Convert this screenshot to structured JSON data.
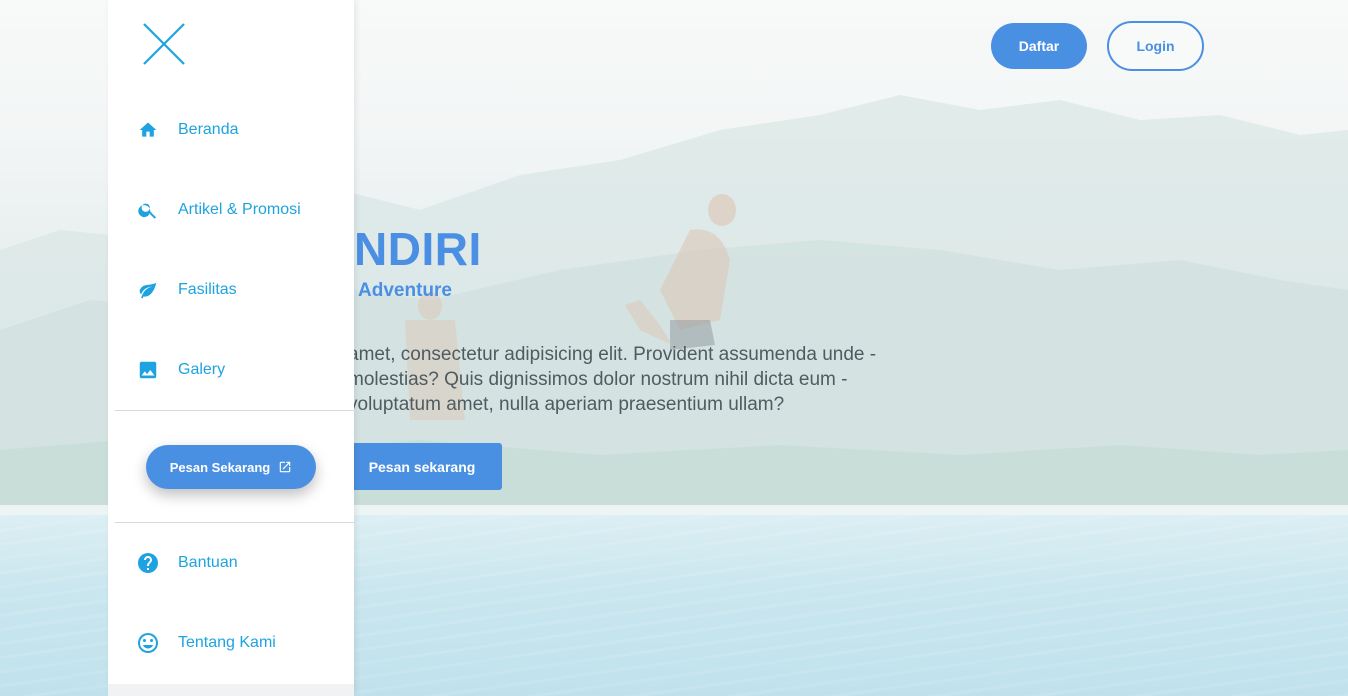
{
  "header": {
    "register_label": "Daftar",
    "login_label": "Login"
  },
  "hero": {
    "title": "NDIRI",
    "subtitle": "Adventure",
    "body_lines": [
      "amet, consectetur adipisicing elit. Provident assumenda unde -",
      "molestias? Quis dignissimos dolor nostrum nihil dicta eum -",
      "voluptatum amet, nulla aperiam praesentium ullam?"
    ],
    "cta_label": "Pesan sekarang"
  },
  "drawer": {
    "close_icon": "close-icon",
    "items": [
      {
        "label": "Beranda",
        "icon": "home-icon"
      },
      {
        "label": "Artikel & Promosi",
        "icon": "search-icon"
      },
      {
        "label": "Fasilitas",
        "icon": "leaf-icon"
      },
      {
        "label": "Galery",
        "icon": "image-icon"
      }
    ],
    "cta_label": "Pesan Sekarang",
    "cta_icon": "external-link-icon",
    "footer_items": [
      {
        "label": "Bantuan",
        "icon": "help-icon"
      },
      {
        "label": "Tentang Kami",
        "icon": "smiley-icon"
      }
    ]
  },
  "colors": {
    "accent": "#4a90e2",
    "drawer_text": "#1ea3e0"
  }
}
